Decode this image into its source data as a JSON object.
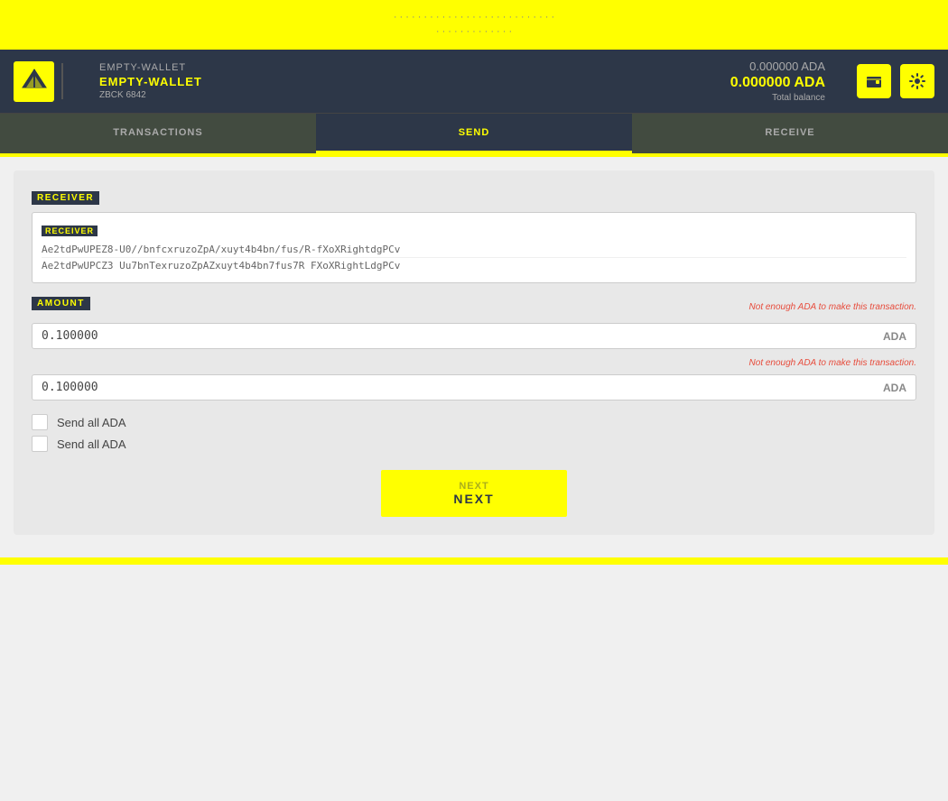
{
  "topBanner": {
    "line1": "· · · · · · · · · · · · · · · · · · · · · · · · · · ·",
    "line2": "· · · · · · · · · · · · ·"
  },
  "header": {
    "walletLabelEmpty": "EMPTY-WALLET",
    "walletNameActive": "EMPTY-WALLET",
    "walletNameLine2": "ZBCK 6842",
    "walletAddressLine1": "ZBCK 6842",
    "balanceEmpty": "0.000000 ADA",
    "balanceMain": "0.000000 ADA",
    "balanceSub": "Total balance"
  },
  "nav": {
    "tabs": [
      {
        "id": "transactions",
        "label": "TRANSACTIONS"
      },
      {
        "id": "send",
        "label": "SEND"
      },
      {
        "id": "receive",
        "label": "RECEIVE"
      }
    ]
  },
  "form": {
    "receiverSectionLabel": "RECEIVER",
    "receiverInnerLabel": "RECEIVER",
    "receiverAddress1": "Ae2tdPwUPEZ8-U0//bnfcxruzoZpA/xuyt4b4bn/fus/R-fXoXRightdgPCv",
    "receiverAddress2": "Ae2tdPwUPCZ3 Uu7bnTexruzoZpAZxuyt4b4bn7fus7R FXoXRightLdgPCv",
    "amountSectionLabel": "AMOUNT",
    "amountErrorMsg1": "Not enough ADA to make this transaction.",
    "amountErrorMsg2": "Not enough ADA to make this transaction.",
    "amount1": "0.100000",
    "amount2": "0.100000",
    "currency": "ADA",
    "sendAllAda1": "Send all ADA",
    "sendAllAda2": "Send all ADA",
    "nextButtonLabel": "Next",
    "nextButtonLabelAlt": "Next"
  }
}
